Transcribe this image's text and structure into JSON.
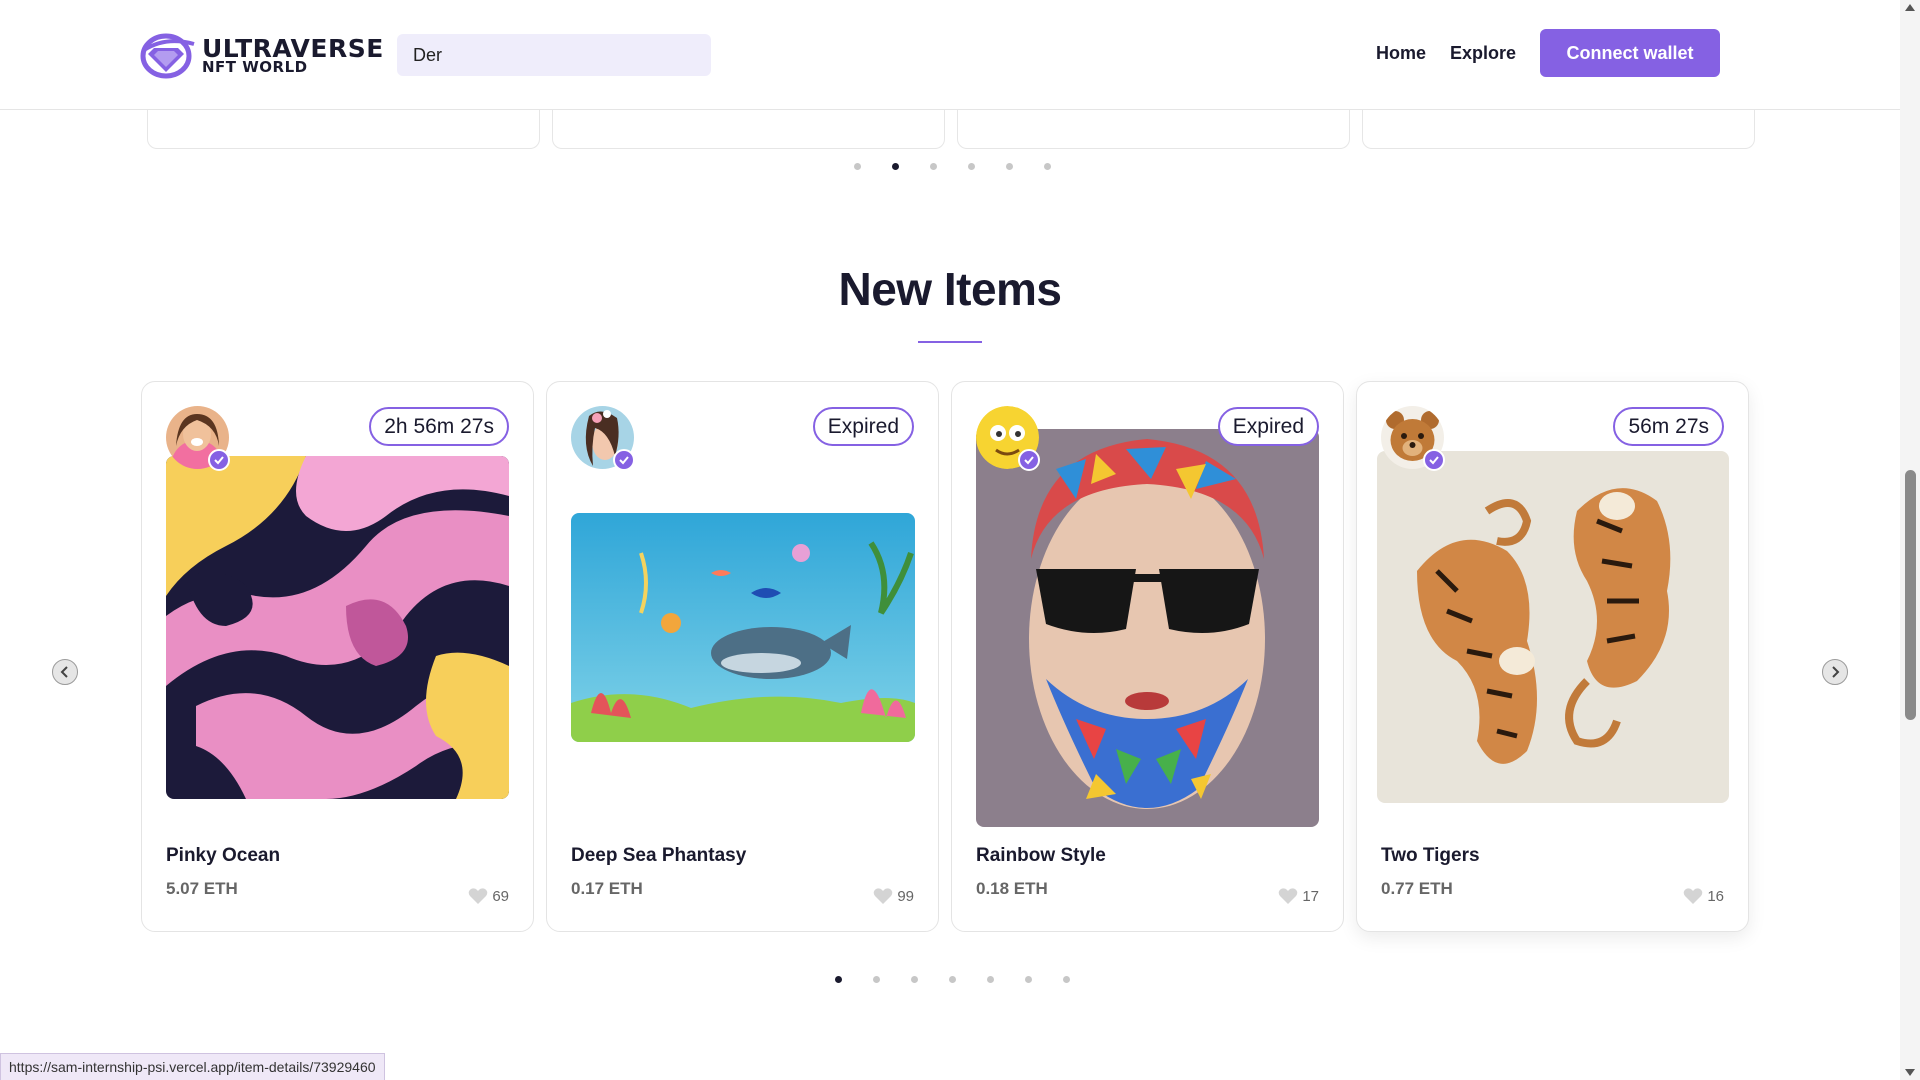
{
  "header": {
    "logo_line1": "ULTRAVERSE",
    "logo_line2": "NFT WORLD",
    "search_value": "Der",
    "nav": {
      "home": "Home",
      "explore": "Explore"
    },
    "connect_wallet": "Connect wallet"
  },
  "top_carousel": {
    "dot_count": 6,
    "active_dot": 2
  },
  "new_items": {
    "title": "New Items",
    "cards": [
      {
        "title": "Pinky Ocean",
        "price": "5.07 ETH",
        "likes": "69",
        "timer": "2h 56m 27s"
      },
      {
        "title": "Deep Sea Phantasy",
        "price": "0.17 ETH",
        "likes": "99",
        "timer": "Expired"
      },
      {
        "title": "Rainbow Style",
        "price": "0.18 ETH",
        "likes": "17",
        "timer": "Expired"
      },
      {
        "title": "Two Tigers",
        "price": "0.77 ETH",
        "likes": "16",
        "timer": "56m 27s"
      }
    ],
    "dot_count": 7,
    "active_dot": 1
  },
  "colors": {
    "accent": "#8561e3",
    "text": "#1a1a2e",
    "search_bg": "#efedfb"
  },
  "status_bar_url": "https://sam-internship-psi.vercel.app/item-details/73929460"
}
